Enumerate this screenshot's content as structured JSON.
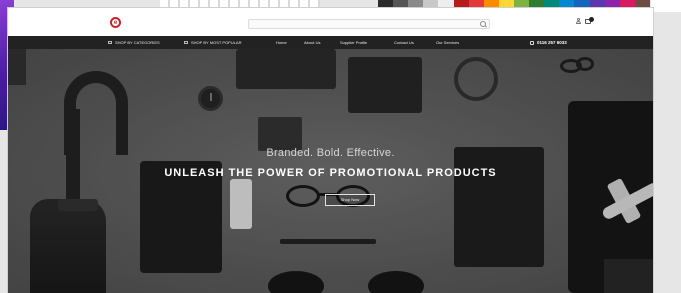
{
  "background": {
    "left_banner_text": "",
    "swatch_colors": [
      "#2b2b2b",
      "#555555",
      "#8a8a8a",
      "#c8c8c8",
      "#eeeeee",
      "#b71c1c",
      "#e53935",
      "#fb8c00",
      "#fdd835",
      "#7cb342",
      "#2e7d32",
      "#00897b",
      "#0288d1",
      "#1565c0",
      "#5e35b1",
      "#8e24aa",
      "#d81b60",
      "#6d4c41"
    ]
  },
  "header": {
    "logo": {
      "name": "",
      "tagline": ""
    },
    "search": {
      "placeholder": ""
    },
    "cart_count": ""
  },
  "nav": {
    "items": [
      {
        "label": "SHOP BY CATEGORIES"
      },
      {
        "label": "SHOP BY MOST POPULAR"
      },
      {
        "label": "Home"
      },
      {
        "label": "About Us"
      },
      {
        "label": "Supplier Profile"
      },
      {
        "label": "Contact Us"
      },
      {
        "label": "Our Services"
      }
    ],
    "phone": "0116 257 6033"
  },
  "hero": {
    "tagline": "Branded. Bold. Effective.",
    "headline": "UNLEASH THE POWER OF PROMOTIONAL PRODUCTS",
    "cta_label": "Shop Now"
  },
  "colors": {
    "brand_red": "#c4242b",
    "nav_bg": "#222222",
    "hero_bg": "#575757"
  }
}
